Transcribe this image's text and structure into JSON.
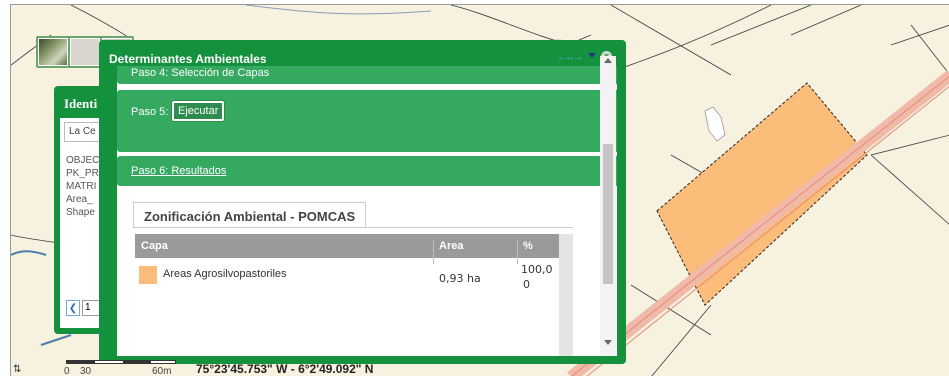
{
  "colors": {
    "widget_green": "#14913c",
    "step_green": "#35a960",
    "polygon_fill": "#fdbd7a",
    "map_bg": "#f7f1df",
    "road": "#f0b9a8"
  },
  "identify_panel": {
    "title": "Identi",
    "select_value": "La Ce",
    "attributes": [
      "OBJEC",
      "PK_PR",
      "MATRI",
      "Area_",
      "Shape"
    ],
    "prev_icon": "chevron-left-icon",
    "page_value": "1"
  },
  "widget": {
    "title": "Determinantes Ambientales",
    "icons": [
      "drag-arrows-icon",
      "minimize-icon",
      "close-icon"
    ],
    "step4_label": "Paso 4: Selección de Capas",
    "step5_label": "Paso 5:",
    "execute_button": "Ejecutar",
    "step6_label": "Paso 6: Resultados",
    "tab_label": "Zonificación Ambiental - POMCAS",
    "table": {
      "headers": [
        "Capa",
        "Area",
        "%"
      ],
      "rows": [
        {
          "capa": "Areas Agrosilvopastoriles",
          "area": "0,93 ha",
          "pct_line1": "100,0",
          "pct_line2": "0"
        }
      ]
    }
  },
  "footer": {
    "scale_labels": [
      "0",
      "30",
      "60m"
    ],
    "coordinates": "75°23'45.753\" W - 6°2'49.092\" N",
    "side_icon": "arrows-icon"
  }
}
